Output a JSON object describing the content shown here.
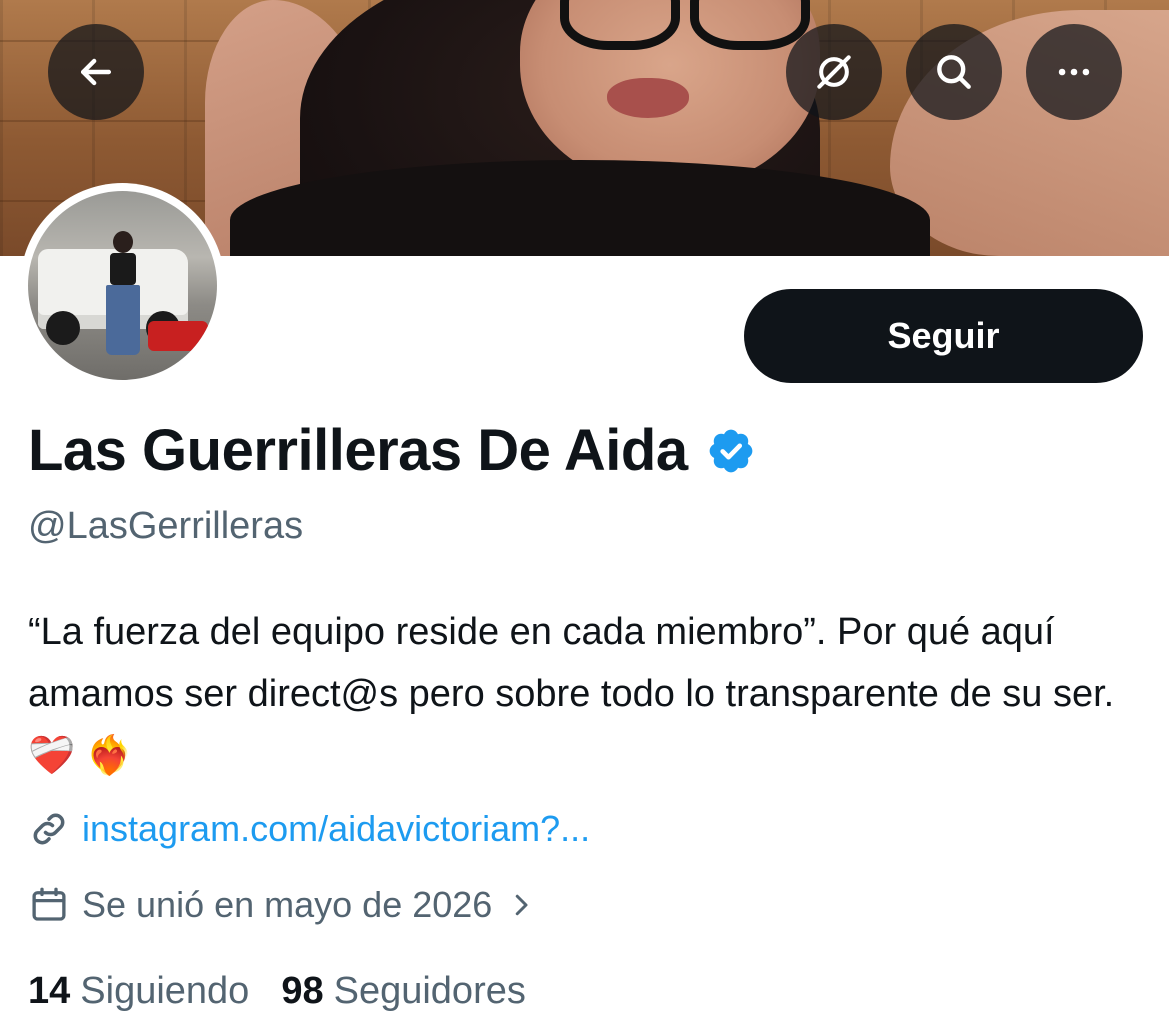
{
  "profile": {
    "display_name": "Las Guerrilleras De Aida",
    "handle": "@LasGerrilleras",
    "bio": "“La fuerza del equipo reside en cada miembro”. Por qué aquí amamos ser direct@s pero sobre todo lo transparente de su ser.❤️‍🩹 ❤️‍🔥",
    "link": "instagram.com/aidavictoriam?...",
    "joined": "Se unió en mayo de 2026",
    "verified": true
  },
  "actions": {
    "follow_label": "Seguir"
  },
  "stats": {
    "following_count": "14",
    "following_label": "Siguiendo",
    "followers_count": "98",
    "followers_label": "Seguidores"
  },
  "icons": {
    "back": "arrow-left-icon",
    "grok": "grok-icon",
    "search": "search-icon",
    "more": "more-icon",
    "verified": "verified-badge-icon",
    "link": "link-icon",
    "calendar": "calendar-icon",
    "chevron": "chevron-right-icon"
  },
  "colors": {
    "accent": "#1d9bf0",
    "text_primary": "#0f1419",
    "text_secondary": "#536471",
    "button_bg": "#0f1419"
  }
}
